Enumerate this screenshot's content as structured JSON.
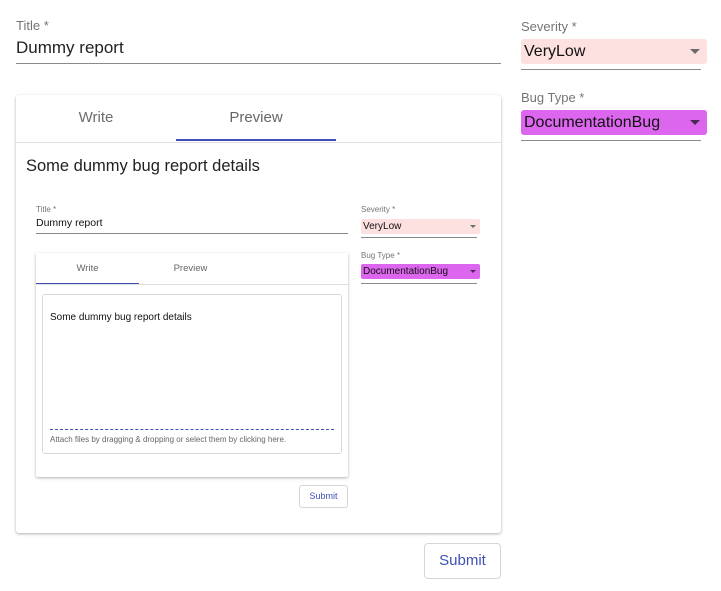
{
  "form": {
    "title_label": "Title *",
    "title_value": "Dummy report",
    "severity_label": "Severity *",
    "severity_value": "VeryLow",
    "bug_type_label": "Bug Type *",
    "bug_type_value": "DocumentationBug",
    "tabs": [
      {
        "label": "Write",
        "active": false
      },
      {
        "label": "Preview",
        "active": true
      }
    ],
    "preview_text": "Some dummy bug report details",
    "submit_label": "Submit"
  },
  "nested_preview": {
    "title_label": "Title *",
    "title_value": "Dummy report",
    "severity_label": "Severity *",
    "severity_value": "VeryLow",
    "bug_type_label": "Bug Type *",
    "bug_type_value": "DocumentationBug",
    "tabs": [
      {
        "label": "Write",
        "active": true
      },
      {
        "label": "Preview",
        "active": false
      }
    ],
    "editor_text": "Some dummy bug report details",
    "attach_hint": "Attach files by dragging & dropping or select them by clicking here.",
    "submit_label": "Submit"
  },
  "colors": {
    "accent": "#3f51b5",
    "severity_bg": "#fde0e0",
    "bug_type_bg": "#dd66ee"
  },
  "icons": {
    "dropdown": "caret-down-icon"
  }
}
